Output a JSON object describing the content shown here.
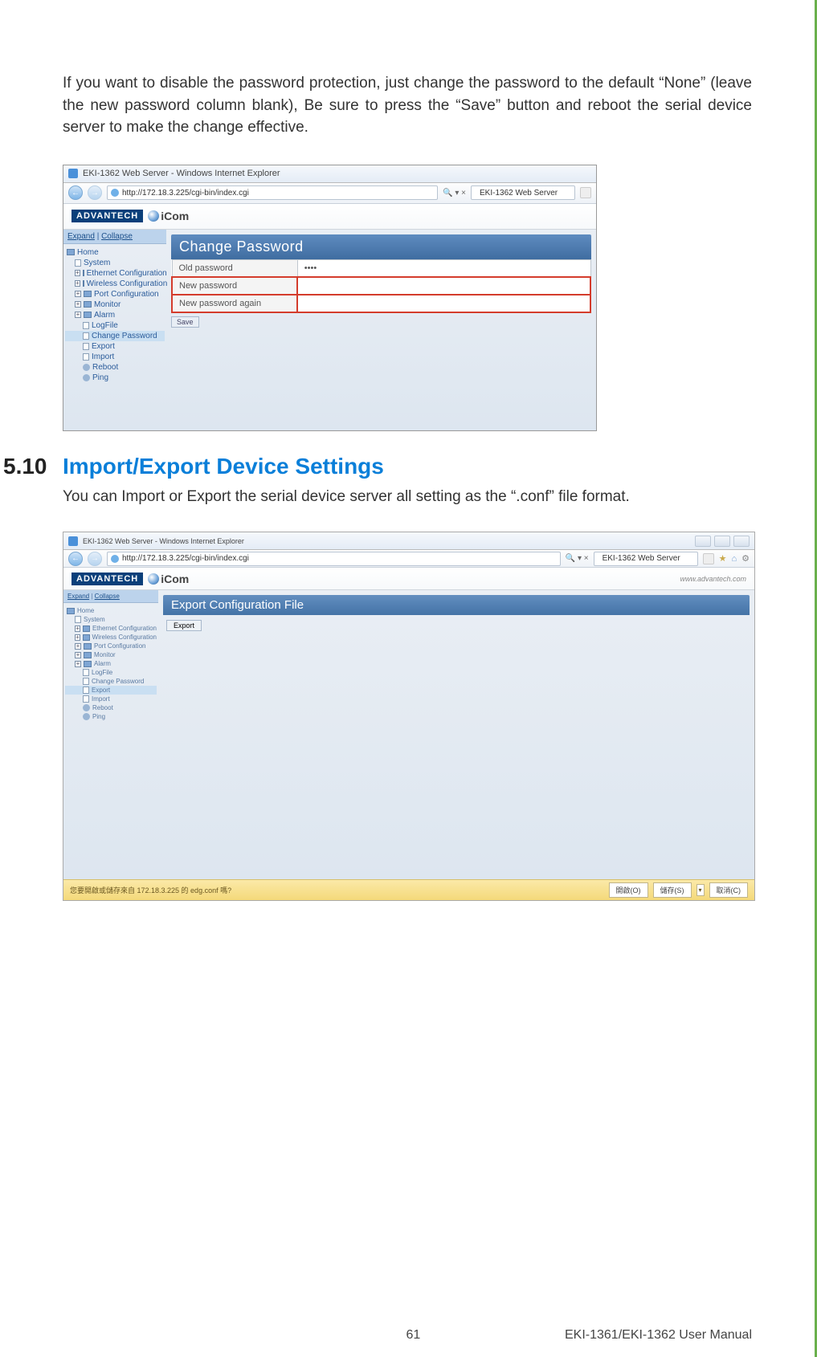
{
  "para1": "If you want to disable the password protection, just change the password to the default “None” (leave the new password column blank), Be sure to press the “Save” button and reboot the serial device server to make the change effective.",
  "section": {
    "num": "5.10",
    "title": "Import/Export Device Settings"
  },
  "para2": "You can Import or Export the serial device server all setting as the “.conf” file format.",
  "ss1": {
    "window_title": "EKI-1362 Web Server - Windows Internet Explorer",
    "url": "http://172.18.3.225/cgi-bin/index.cgi",
    "search_hint": "🔍  ▾  ×",
    "tab": "EKI-1362 Web Server",
    "brand": "ADVANTECH",
    "brand2": "iCom",
    "expand": "Expand",
    "collapse": "Collapse",
    "tree": [
      {
        "lvl": 0,
        "t": "Home",
        "ico": "folder"
      },
      {
        "lvl": 1,
        "t": "System",
        "ico": "page"
      },
      {
        "lvl": 1,
        "t": "Ethernet Configuration",
        "ico": "folder",
        "plus": true
      },
      {
        "lvl": 1,
        "t": "Wireless Configuration",
        "ico": "folder",
        "plus": true
      },
      {
        "lvl": 1,
        "t": "Port Configuration",
        "ico": "folder",
        "plus": true
      },
      {
        "lvl": 1,
        "t": "Monitor",
        "ico": "folder",
        "plus": true
      },
      {
        "lvl": 1,
        "t": "Alarm",
        "ico": "folder",
        "plus": true
      },
      {
        "lvl": 2,
        "t": "LogFile",
        "ico": "page"
      },
      {
        "lvl": 2,
        "t": "Change Password",
        "ico": "page",
        "sel": true
      },
      {
        "lvl": 2,
        "t": "Export",
        "ico": "page"
      },
      {
        "lvl": 2,
        "t": "Import",
        "ico": "page"
      },
      {
        "lvl": 2,
        "t": "Reboot",
        "ico": "gear"
      },
      {
        "lvl": 2,
        "t": "Ping",
        "ico": "gear"
      }
    ],
    "panel_title": "Change Password",
    "rows": [
      {
        "label": "Old password",
        "val": "••••",
        "red": false
      },
      {
        "label": "New password",
        "val": "",
        "red": true
      },
      {
        "label": "New password again",
        "val": "",
        "red": true
      }
    ],
    "save": "Save"
  },
  "ss2": {
    "window_title": "EKI-1362 Web Server - Windows Internet Explorer",
    "url": "http://172.18.3.225/cgi-bin/index.cgi",
    "tab": "EKI-1362 Web Server",
    "brand": "ADVANTECH",
    "brand2": "iCom",
    "brand_right": "www.advantech.com",
    "expand": "Expand",
    "collapse": "Collapse",
    "tree": [
      {
        "lvl": 0,
        "t": "Home",
        "ico": "folder"
      },
      {
        "lvl": 1,
        "t": "System",
        "ico": "page"
      },
      {
        "lvl": 1,
        "t": "Ethernet Configuration",
        "ico": "folder",
        "plus": true
      },
      {
        "lvl": 1,
        "t": "Wireless Configuration",
        "ico": "folder",
        "plus": true
      },
      {
        "lvl": 1,
        "t": "Port Configuration",
        "ico": "folder",
        "plus": true
      },
      {
        "lvl": 1,
        "t": "Monitor",
        "ico": "folder",
        "plus": true
      },
      {
        "lvl": 1,
        "t": "Alarm",
        "ico": "folder",
        "plus": true
      },
      {
        "lvl": 2,
        "t": "LogFile",
        "ico": "page"
      },
      {
        "lvl": 2,
        "t": "Change Password",
        "ico": "page"
      },
      {
        "lvl": 2,
        "t": "Export",
        "ico": "page",
        "sel": true
      },
      {
        "lvl": 2,
        "t": "Import",
        "ico": "page"
      },
      {
        "lvl": 2,
        "t": "Reboot",
        "ico": "gear"
      },
      {
        "lvl": 2,
        "t": "Ping",
        "ico": "gear"
      }
    ],
    "panel_title": "Export Configuration File",
    "export_btn": "Export",
    "dl_msg": "您要開啟或儲存來自 172.18.3.225 的 edg.conf 嗎?",
    "dl_open": "開啟(O)",
    "dl_save": "儲存(S)",
    "dl_cancel": "取消(C)"
  },
  "footer": {
    "page": "61",
    "manual": "EKI-1361/EKI-1362 User Manual"
  }
}
